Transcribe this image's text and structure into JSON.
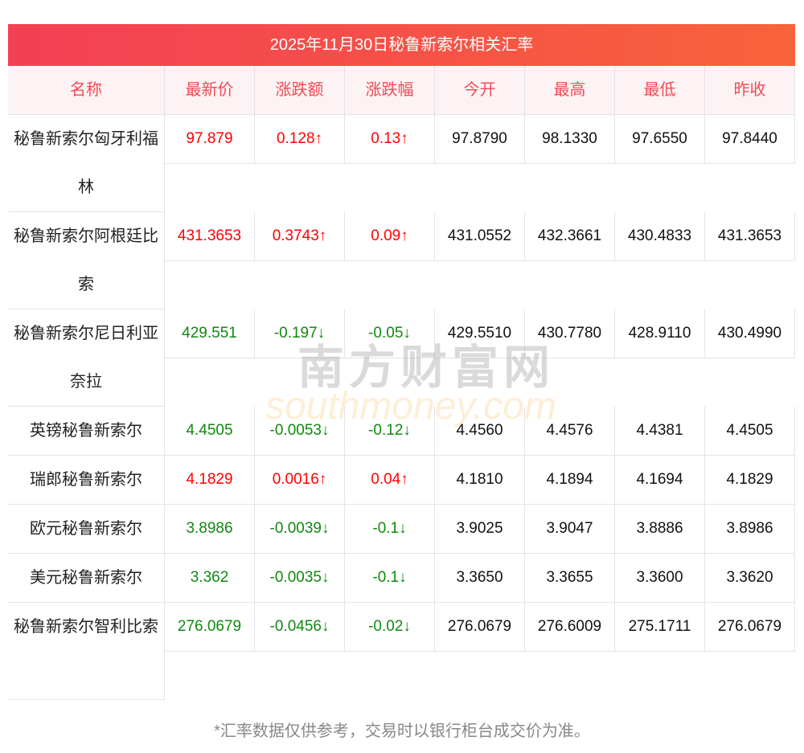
{
  "title": "2025年11月30日秘鲁新索尔相关汇率",
  "headers": [
    "名称",
    "最新价",
    "涨跌额",
    "涨跌幅",
    "今开",
    "最高",
    "最低",
    "昨收"
  ],
  "rows": [
    {
      "name": "秘鲁新索尔匈牙利福林",
      "latest": "97.879",
      "change": "0.128↑",
      "pct": "0.13↑",
      "open": "97.8790",
      "high": "98.1330",
      "low": "97.6550",
      "prev": "97.8440",
      "dir": "up",
      "lines": 2
    },
    {
      "name": "秘鲁新索尔阿根廷比索",
      "latest": "431.3653",
      "change": "0.3743↑",
      "pct": "0.09↑",
      "open": "431.0552",
      "high": "432.3661",
      "low": "430.4833",
      "prev": "431.3653",
      "dir": "up",
      "lines": 2
    },
    {
      "name": "秘鲁新索尔尼日利亚奈拉",
      "latest": "429.551",
      "change": "-0.197↓",
      "pct": "-0.05↓",
      "open": "429.5510",
      "high": "430.7780",
      "low": "428.9110",
      "prev": "430.4990",
      "dir": "down",
      "lines": 2
    },
    {
      "name": "英镑秘鲁新索尔",
      "latest": "4.4505",
      "change": "-0.0053↓",
      "pct": "-0.12↓",
      "open": "4.4560",
      "high": "4.4576",
      "low": "4.4381",
      "prev": "4.4505",
      "dir": "down",
      "lines": 1
    },
    {
      "name": "瑞郎秘鲁新索尔",
      "latest": "4.1829",
      "change": "0.0016↑",
      "pct": "0.04↑",
      "open": "4.1810",
      "high": "4.1894",
      "low": "4.1694",
      "prev": "4.1829",
      "dir": "up",
      "lines": 1
    },
    {
      "name": "欧元秘鲁新索尔",
      "latest": "3.8986",
      "change": "-0.0039↓",
      "pct": "-0.1↓",
      "open": "3.9025",
      "high": "3.9047",
      "low": "3.8886",
      "prev": "3.8986",
      "dir": "down",
      "lines": 1
    },
    {
      "name": "美元秘鲁新索尔",
      "latest": "3.362",
      "change": "-0.0035↓",
      "pct": "-0.1↓",
      "open": "3.3650",
      "high": "3.3655",
      "low": "3.3600",
      "prev": "3.3620",
      "dir": "down",
      "lines": 1
    },
    {
      "name": "秘鲁新索尔智利比索",
      "latest": "276.0679",
      "change": "-0.0456↓",
      "pct": "-0.02↓",
      "open": "276.0679",
      "high": "276.6009",
      "low": "275.1711",
      "prev": "276.0679",
      "dir": "down",
      "lines": 2
    }
  ],
  "note": "*汇率数据仅供参考，交易时以银行柜台成交价为准。",
  "watermark": {
    "cn": "南方财富网",
    "en": "southmoney.com"
  },
  "colors": {
    "up": "#ff0000",
    "down": "#118811",
    "header": "#f24a55"
  }
}
